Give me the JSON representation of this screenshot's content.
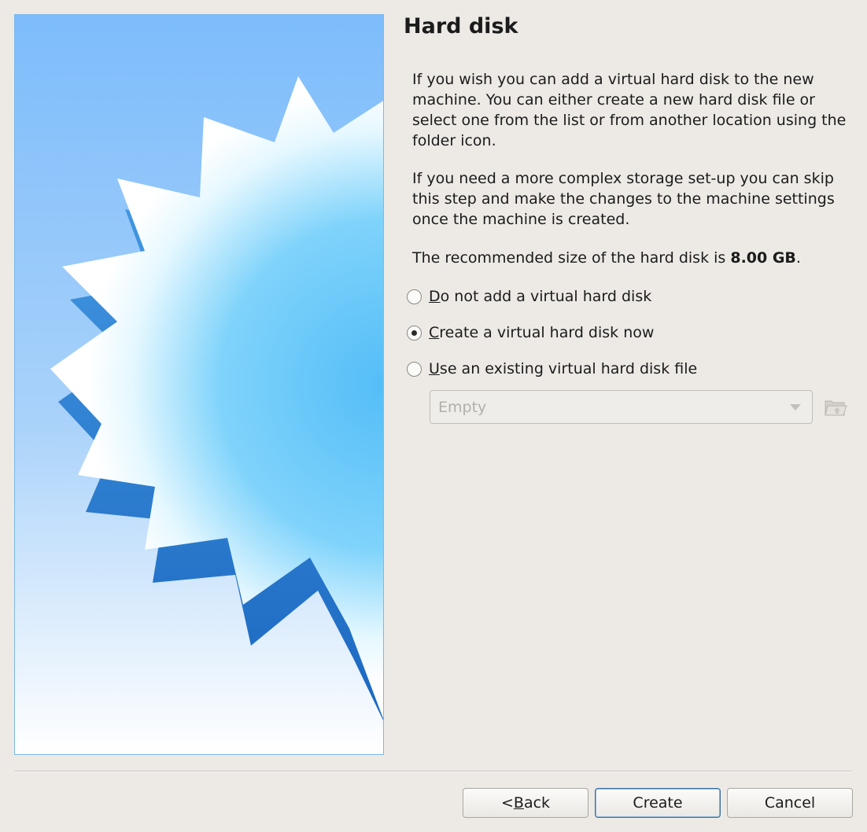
{
  "wizard": {
    "title": "Hard disk",
    "paragraph_1": "If you wish you can add a virtual hard disk to the new machine. You can either create a new hard disk file or select one from the list or from another location using the folder icon.",
    "paragraph_2": "If you need a more complex storage set-up you can skip this step and make the changes to the machine settings once the machine is created.",
    "recommended_prefix": "The recommended size of the hard disk is ",
    "recommended_size": "8.00 GB",
    "recommended_suffix": "."
  },
  "options": [
    {
      "mnemonic": "D",
      "rest": "o not add a virtual hard disk",
      "checked": false
    },
    {
      "mnemonic": "C",
      "rest": "reate a virtual hard disk now",
      "checked": true
    },
    {
      "mnemonic": "U",
      "rest": "se an existing virtual hard disk file",
      "checked": false
    }
  ],
  "disk_selector": {
    "value": "Empty",
    "enabled": false,
    "folder_icon": "folder-open-icon"
  },
  "buttons": {
    "back_prefix": "< ",
    "back_mnemonic": "B",
    "back_rest": "ack",
    "create": "Create",
    "cancel": "Cancel"
  },
  "colors": {
    "accent": "#3a6fa0",
    "banner_top": "#7dbcfb",
    "banner_bottom": "#ffffff"
  }
}
